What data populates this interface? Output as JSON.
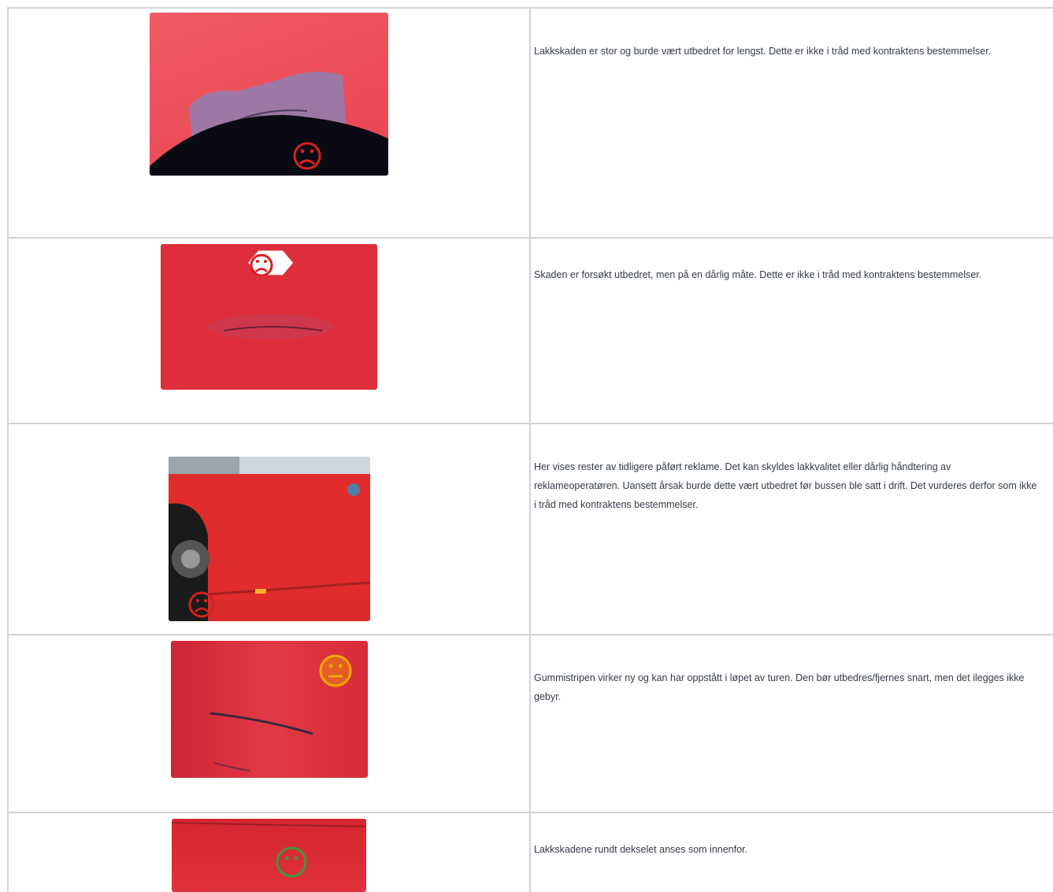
{
  "rows": [
    {
      "description": "Lakkskaden er stor og burde vært utbedret for lengst. Dette er ikke i tråd med kontraktens bestemmelser.",
      "rating_icon": "sad-face-icon",
      "rating_color": "#d8201e",
      "photo_icon": "paint-damage-photo"
    },
    {
      "description": "Skaden er forsøkt utbedret, men på en dårlig måte. Dette er ikke i tråd med kontraktens bestemmelser.",
      "rating_icon": "sad-face-icon",
      "rating_color": "#d8201e",
      "photo_icon": "repaired-scratch-photo"
    },
    {
      "description": "Her vises rester av tidligere påført reklame. Det kan skyldes lakkvalitet eller dårlig håndtering av reklameoperatøren. Uansett årsak burde dette vært utbedret før bussen ble satt i drift. Det vurderes derfor som ikke i tråd med kontraktens bestemmelser.",
      "rating_icon": "sad-face-icon",
      "rating_color": "#d8201e",
      "photo_icon": "bus-side-photo"
    },
    {
      "description": "Gummistripen virker ny og kan har oppstått i løpet av turen. Den bør utbedres/fjernes snart, men det ilegges ikke gebyr.",
      "rating_icon": "neutral-face-icon",
      "rating_color": "#f5a800",
      "photo_icon": "rubber-stripe-photo"
    },
    {
      "description": "Lakkskadene rundt dekselet anses som innenfor.",
      "rating_icon": "happy-face-icon",
      "rating_color": "#3a9a3a",
      "photo_icon": "cover-paint-photo"
    }
  ]
}
